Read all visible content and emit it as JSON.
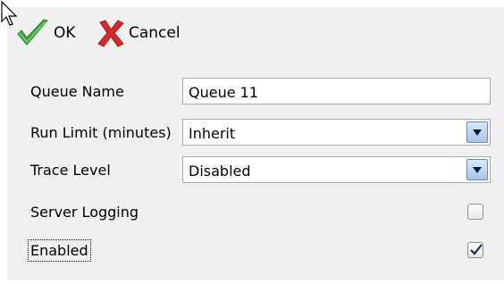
{
  "toolbar": {
    "ok_label": "OK",
    "cancel_label": "Cancel",
    "ok_icon": "checkmark-icon",
    "cancel_icon": "x-icon",
    "ok_color": "#3ca33c",
    "cancel_color": "#d42a2a"
  },
  "form": {
    "queue_name": {
      "label": "Queue Name",
      "value": "Queue 11"
    },
    "run_limit": {
      "label": "Run Limit (minutes)",
      "value": "Inherit"
    },
    "trace_level": {
      "label": "Trace Level",
      "value": "Disabled"
    },
    "server_logging": {
      "label": "Server Logging",
      "checked": false
    },
    "enabled": {
      "label": "Enabled",
      "checked": true
    }
  }
}
